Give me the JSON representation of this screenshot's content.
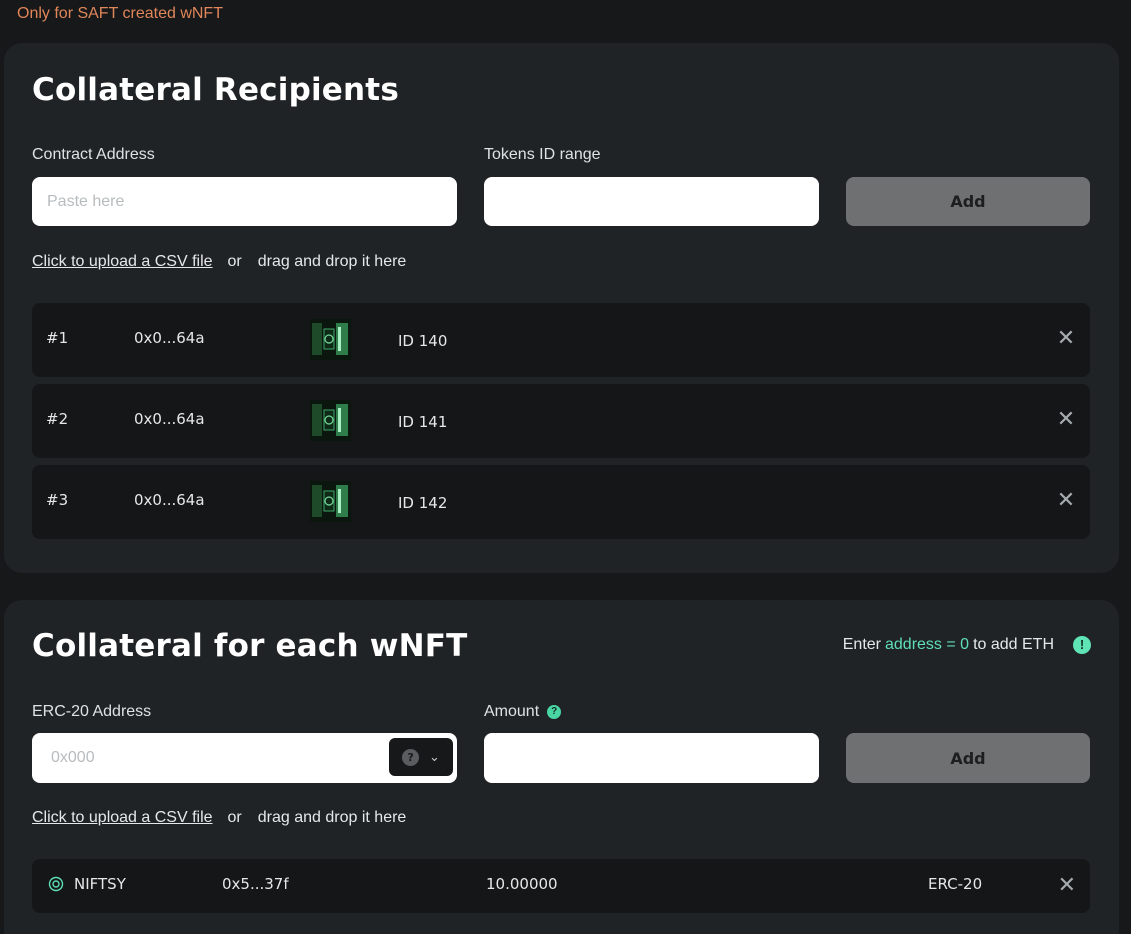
{
  "top_note": "Only for SAFT created wNFT",
  "recipients": {
    "title": "Collateral Recipients",
    "contract_label": "Contract Address",
    "contract_placeholder": "Paste here",
    "contract_value": "",
    "range_label": "Tokens ID range",
    "range_value": "",
    "add_label": "Add",
    "upload_link": "Click to upload a CSV file",
    "upload_or": "or",
    "upload_drag": "drag and drop it here",
    "rows": [
      {
        "num": "#1",
        "address": "0x0...64a",
        "token_id": "ID 140"
      },
      {
        "num": "#2",
        "address": "0x0...64a",
        "token_id": "ID 141"
      },
      {
        "num": "#3",
        "address": "0x0...64a",
        "token_id": "ID 142"
      }
    ]
  },
  "collateral": {
    "title": "Collateral for each wNFT",
    "hint_pre": "Enter",
    "hint_accent": "address = 0",
    "hint_post": "to add ETH",
    "hint_icon": "!",
    "erc_label": "ERC-20 Address",
    "erc_placeholder": "0x000",
    "erc_value": "",
    "token_icon": "?",
    "amount_label": "Amount",
    "amount_help": "?",
    "amount_value": "",
    "add_label": "Add",
    "upload_link": "Click to upload a CSV file",
    "upload_or": "or",
    "upload_drag": "drag and drop it here",
    "items": [
      {
        "token": "NIFTSY",
        "address": "0x5...37f",
        "amount": "10.00000",
        "standard": "ERC-20"
      }
    ]
  },
  "colors": {
    "accent": "#5fdfb4",
    "note": "#e0865a",
    "card": "#1f2325",
    "row": "#141617",
    "button": "#6e7071"
  }
}
